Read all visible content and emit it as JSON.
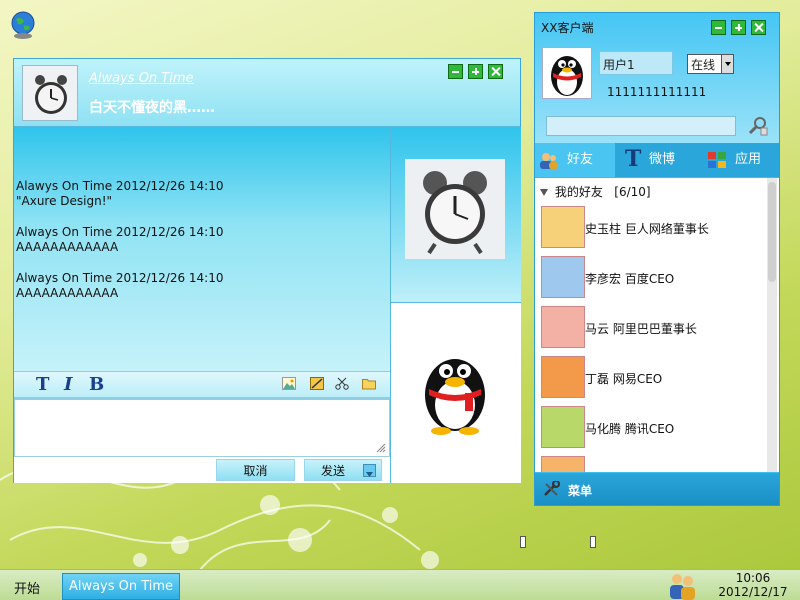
{
  "desktop": {
    "icon": "globe-icon"
  },
  "chat_window": {
    "contact_name": "Always On Time",
    "signature": "白天不懂夜的黑……",
    "messages": [
      {
        "header": "Alawys On Time 2012/12/26 14:10",
        "text": "\"Axure Design!\""
      },
      {
        "header": "Always On Time 2012/12/26 14:10",
        "text": "AAAAAAAAAAAA"
      },
      {
        "header": "Always On Time 2012/12/26 14:10",
        "text": "AAAAAAAAAAAA"
      }
    ],
    "toolbar": {
      "font_label": "T",
      "italic_label": "I",
      "bold_label": "B"
    },
    "input_value": "",
    "cancel_label": "取消",
    "send_label": "发送"
  },
  "client_window": {
    "title": "XX客户端",
    "username": "用户1",
    "status": "在线",
    "qq_number": "1111111111111",
    "search_value": "",
    "tabs": [
      {
        "label": "好友",
        "icon": "friends-icon",
        "active": true
      },
      {
        "label": "微博",
        "icon": "weibo-icon",
        "active": false
      },
      {
        "label": "应用",
        "icon": "apps-icon",
        "active": false
      }
    ],
    "group": {
      "name": "我的好友",
      "count": "[6/10]"
    },
    "friends": [
      {
        "name": "史玉柱 巨人网络董事长"
      },
      {
        "name": "李彦宏  百度CEO"
      },
      {
        "name": "马云  阿里巴巴董事长"
      },
      {
        "name": "丁磊  网易CEO"
      },
      {
        "name": "马化腾  腾讯CEO"
      }
    ],
    "menu_label": "菜单"
  },
  "taskbar": {
    "start_label": "开始",
    "task_item": "Always On Time",
    "time": "10:06",
    "date": "2012/12/17"
  },
  "colors": {
    "accent": "#2aa6da",
    "window_button": "#2fb83a"
  }
}
